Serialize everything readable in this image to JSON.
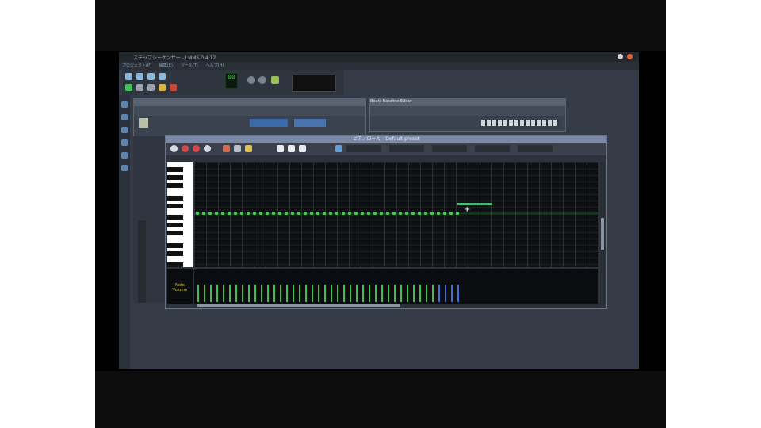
{
  "window": {
    "title": "ステップシーケンサー - LMMS 0.4.12"
  },
  "menu": [
    "プロジェクト(P)",
    "編集(E)",
    "ツール(T)",
    "ヘルプ(H)"
  ],
  "transport": {
    "led_value": "00"
  },
  "beat_editor": {
    "title": "Beat+Bassline Editor"
  },
  "piano_roll": {
    "title": "ピアノロール - Default preset",
    "velocity_label": "Note Volume"
  },
  "colors": {
    "note": "#39d24a",
    "velocity_bar": "#3fbf4a",
    "velocity_bar_selected": "#3a6fd6",
    "panel": "#353c48"
  },
  "icons": [
    "play-icon",
    "record-icon",
    "stop-icon",
    "pencil-icon",
    "select-icon",
    "zoom-icon",
    "cut-icon",
    "copy-icon",
    "paste-icon"
  ]
}
